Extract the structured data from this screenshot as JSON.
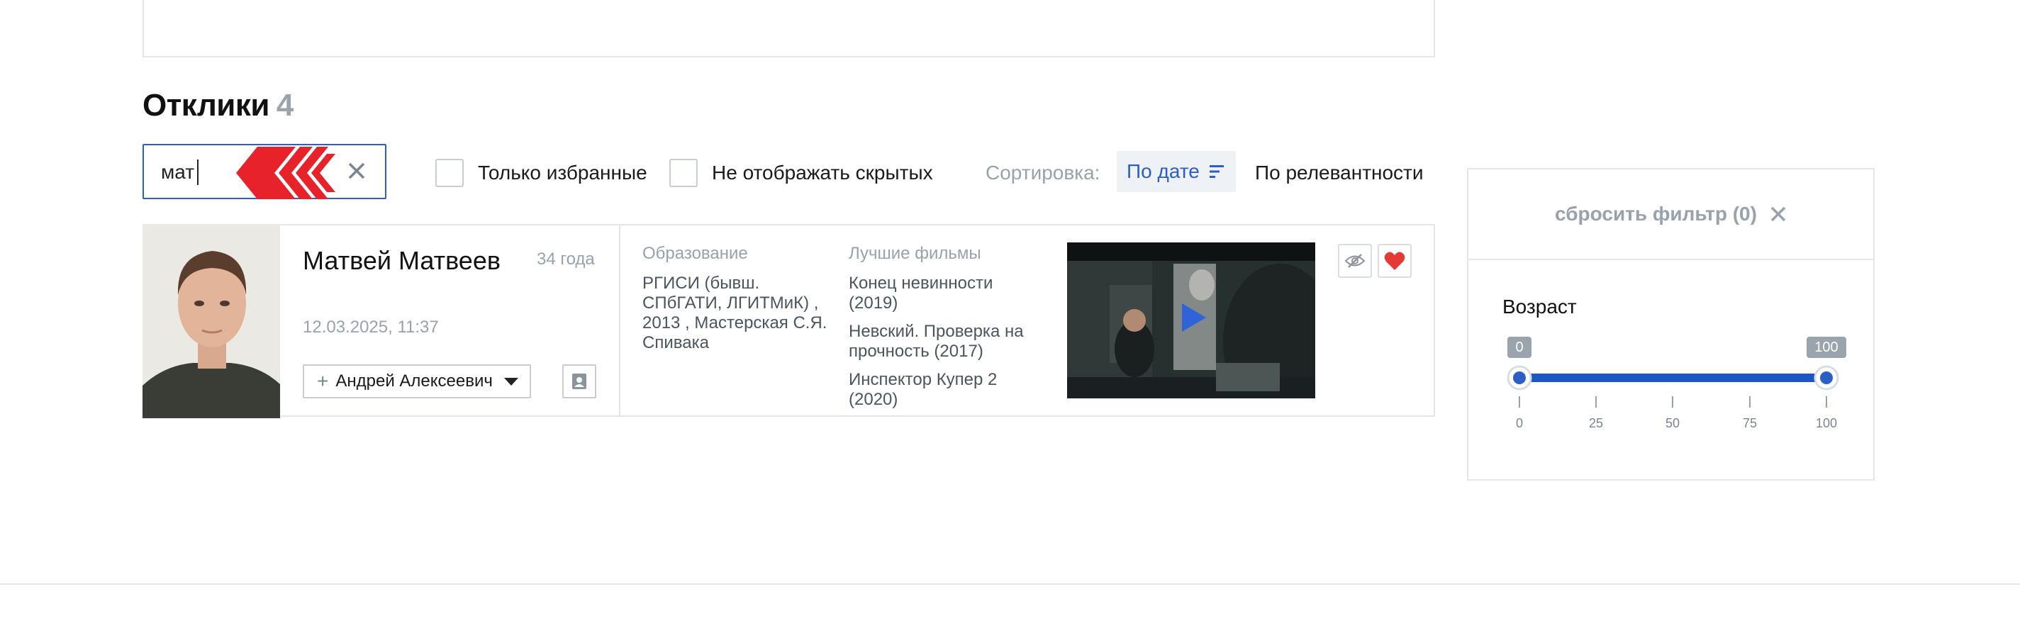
{
  "responses": {
    "title": "Отклики",
    "count": "4"
  },
  "search": {
    "value": "мат"
  },
  "filters": {
    "only_favorites": "Только избранные",
    "hide_hidden": "Не отображать скрытых"
  },
  "sort": {
    "label": "Сортировка:",
    "by_date": "По дате",
    "by_relevance": "По релевантности"
  },
  "candidate": {
    "name": "Матвей Матвеев",
    "age": "34 года",
    "date": "12.03.2025, 11:37",
    "recruiter": "Андрей Алексеевич",
    "education_header": "Образование",
    "education": "РГИСИ (бывш. СПбГАТИ, ЛГИТМиК) , 2013 , Мастерская С.Я. Спивака",
    "films_header": "Лучшие фильмы",
    "films": [
      "Конец невинности (2019)",
      "Невский. Проверка на прочность (2017)",
      "Инспектор Купер 2 (2020)"
    ]
  },
  "filter_panel": {
    "reset_label": "сбросить фильтр (0)",
    "age_title": "Возраст",
    "age_min": "0",
    "age_max": "100",
    "ticks": [
      "0",
      "25",
      "50",
      "75",
      "100"
    ]
  },
  "colors": {
    "accent": "#2b5fc6",
    "slider": "#1a56c4",
    "heart": "#e53935",
    "muted": "#97a2ad"
  }
}
